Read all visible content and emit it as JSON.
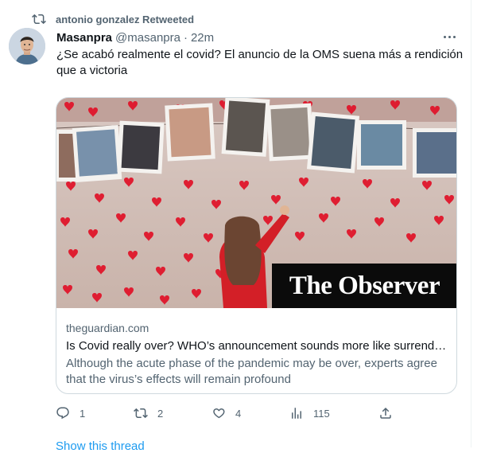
{
  "retweet": {
    "text": "antonio gonzalez Retweeted",
    "icon": "retweet-icon"
  },
  "tweet": {
    "author_name": "Masanpra",
    "handle": "@masanpra",
    "separator": "·",
    "time": "22m",
    "text": "¿Se acabó realmente el covid? El anuncio de la OMS suena más a rendición que a victoria",
    "more_icon": "more-options-icon"
  },
  "card": {
    "image_overlay": "The Observer",
    "domain": "theguardian.com",
    "title": "Is Covid really over? WHO’s announcement sounds more like surrender than victory",
    "description": "Although the acute phase of the pandemic may be over, experts agree that the virus’s effects will remain profound"
  },
  "actions": {
    "reply_count": "1",
    "retweet_count": "2",
    "like_count": "4",
    "views_count": "115"
  },
  "show_thread": "Show this thread",
  "colors": {
    "link": "#1d9bf0",
    "secondary": "#536471",
    "heart": "#e0162b"
  }
}
